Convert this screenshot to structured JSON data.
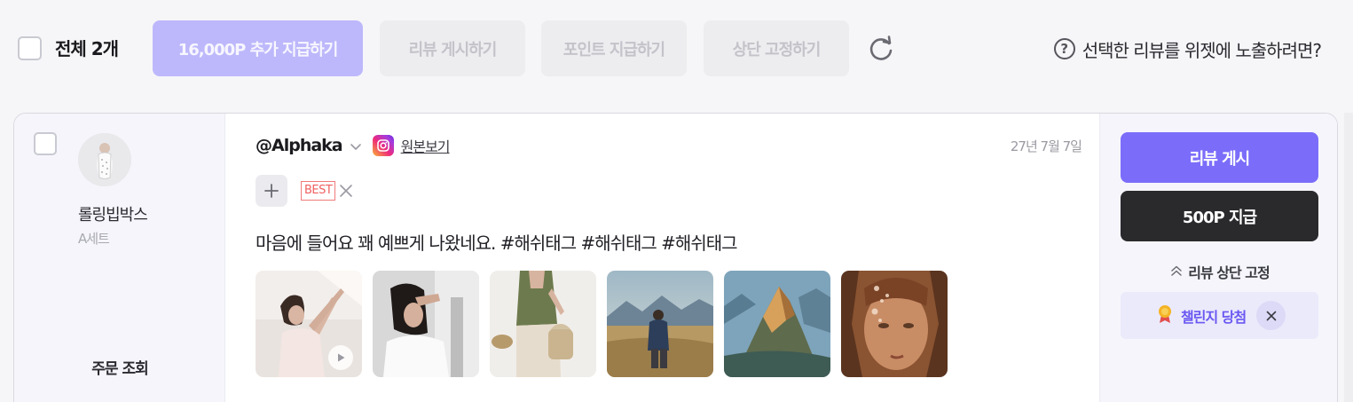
{
  "toolbar": {
    "select_all_label": "전체 2개",
    "buttons": {
      "pay_extra": "16,000P 추가 지급하기",
      "post_reviews": "리뷰 게시하기",
      "give_points": "포인트 지급하기",
      "pin_top": "상단 고정하기"
    },
    "refresh_icon": "refresh-icon",
    "help_text": "선택한 리뷰를 위젯에 노출하려면?",
    "help_icon_glyph": "?"
  },
  "review": {
    "product_name": "롤링빕박스",
    "product_option": "A세트",
    "order_lookup": "주문 조회",
    "username": "@Alphaka",
    "source_link": "원본보기",
    "date": "27년 7월 7일",
    "badge": "BEST",
    "text": "마음에 들어요 꽤 예쁘게 나왔네요. #해쉬태그 #해쉬태그 #해쉬태그",
    "actions": {
      "publish": "리뷰 게시",
      "pay_points": "500P 지급",
      "pin_top": "리뷰 상단 고정",
      "challenge_winner": "챌린지 당첨"
    }
  },
  "colors": {
    "accent": "#7b6dfa",
    "accent_disabled": "#bdb8fb",
    "dark_button": "#2a2a2d",
    "badge_red": "#f05f5f"
  }
}
